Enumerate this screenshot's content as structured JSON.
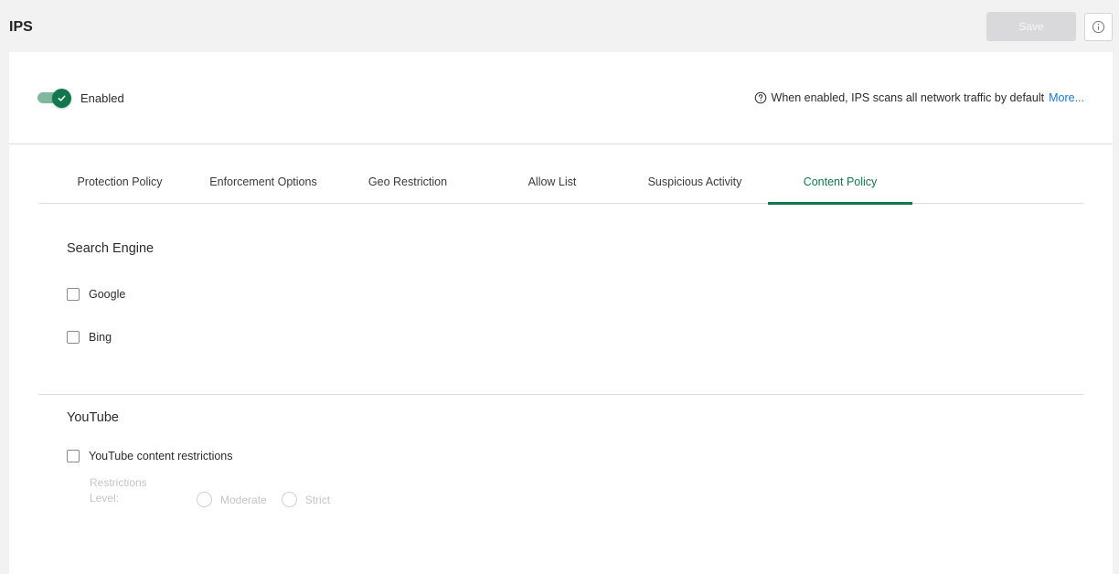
{
  "page": {
    "title": "IPS",
    "save_label": "Save"
  },
  "status": {
    "toggle_label": "Enabled",
    "toggle_on": true,
    "hint_text": "When enabled, IPS scans all network traffic by default",
    "more_link": "More..."
  },
  "tabs": [
    {
      "label": "Protection Policy",
      "active": false
    },
    {
      "label": "Enforcement Options",
      "active": false
    },
    {
      "label": "Geo Restriction",
      "active": false
    },
    {
      "label": "Allow List",
      "active": false
    },
    {
      "label": "Suspicious Activity",
      "active": false
    },
    {
      "label": "Content Policy",
      "active": true
    }
  ],
  "search_engine": {
    "title": "Search Engine",
    "options": [
      {
        "label": "Google",
        "checked": false
      },
      {
        "label": "Bing",
        "checked": false
      }
    ]
  },
  "youtube": {
    "title": "YouTube",
    "restriction_label": "YouTube content restrictions",
    "restriction_checked": false,
    "level_label_line1": "Restrictions",
    "level_label_line2": "Level:",
    "levels": [
      {
        "label": "Moderate",
        "selected": false
      },
      {
        "label": "Strict",
        "selected": false
      }
    ]
  },
  "colors": {
    "accent": "#11784d",
    "link": "#1677d2",
    "disabled_text": "#c4c4c8"
  },
  "icons": {
    "info": "info-icon",
    "help": "help-circle-icon",
    "check": "checkmark-icon"
  }
}
